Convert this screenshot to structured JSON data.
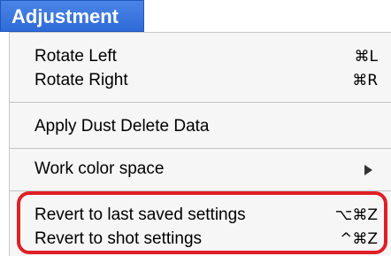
{
  "menu": {
    "title": "Adjustment",
    "items": [
      {
        "label": "Rotate Left",
        "shortcut": "⌘L"
      },
      {
        "label": "Rotate Right",
        "shortcut": "⌘R"
      },
      {
        "label": "Apply Dust Delete Data",
        "shortcut": ""
      },
      {
        "label": "Work color space",
        "shortcut": ""
      },
      {
        "label": "Revert to last saved settings",
        "shortcut": "⌥⌘Z"
      },
      {
        "label": "Revert to shot settings",
        "shortcut": "^⌘Z"
      }
    ]
  },
  "colors": {
    "title_bar": "#3a76e0",
    "menu_background": "#f6f6f6",
    "annotation_outline": "#e01e26"
  },
  "icons": {
    "submenu": "chevron-right-icon"
  }
}
